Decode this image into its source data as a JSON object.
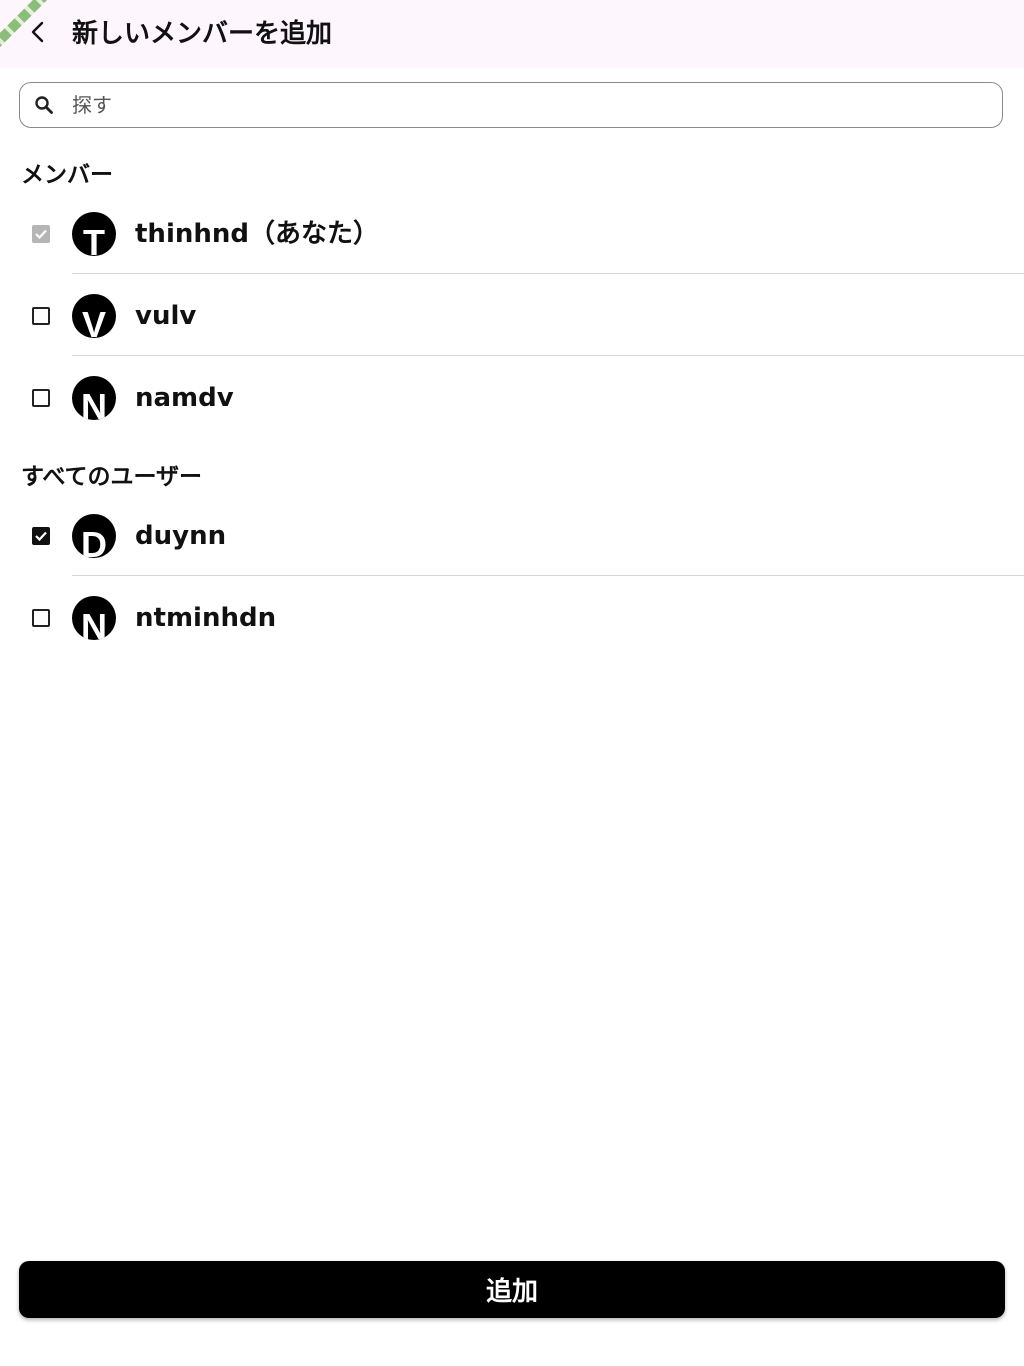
{
  "header": {
    "title": "新しいメンバーを追加",
    "back_icon": "chevron-left-icon"
  },
  "search": {
    "placeholder": "探す",
    "value": ""
  },
  "sections": {
    "members": {
      "title": "メンバー",
      "items": [
        {
          "initial": "T",
          "name": "thinhnd（あなた）",
          "checked": true,
          "disabled": true
        },
        {
          "initial": "V",
          "name": "vulv",
          "checked": false,
          "disabled": false
        },
        {
          "initial": "N",
          "name": "namdv",
          "checked": false,
          "disabled": false
        }
      ]
    },
    "all_users": {
      "title": "すべてのユーザー",
      "items": [
        {
          "initial": "D",
          "name": "duynn",
          "checked": true,
          "disabled": false
        },
        {
          "initial": "N",
          "name": "ntminhdn",
          "checked": false,
          "disabled": false
        }
      ]
    }
  },
  "footer": {
    "add_button_label": "追加"
  },
  "colors": {
    "header_bg": "#fdf6fd",
    "primary": "#000000",
    "divider": "#d6d6d6",
    "disabled_checkbox": "#b5b5b5"
  }
}
